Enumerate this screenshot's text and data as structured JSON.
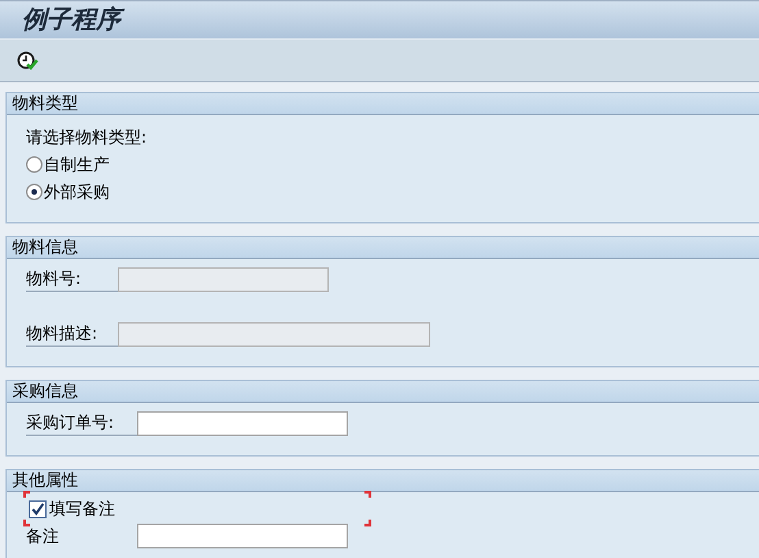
{
  "window": {
    "title": "例子程序"
  },
  "groups": [
    {
      "title": "物料类型",
      "items": [
        {
          "kind": "label",
          "text": "请选择物料类型:"
        },
        {
          "kind": "radio",
          "label": "自制生产",
          "selected": false
        },
        {
          "kind": "radio",
          "label": "外部采购",
          "selected": true
        }
      ]
    },
    {
      "title": "物料信息",
      "items": [
        {
          "kind": "field",
          "label": "物料号:",
          "disabled": true
        },
        {
          "kind": "field",
          "label": "物料描述:",
          "disabled": true
        }
      ]
    },
    {
      "title": "采购信息",
      "items": [
        {
          "kind": "field",
          "label": "采购订单号:",
          "disabled": false
        }
      ]
    },
    {
      "title": "其他属性",
      "items": [
        {
          "kind": "checkbox",
          "label": "填写备注",
          "checked": true,
          "focused": true
        },
        {
          "kind": "field",
          "label": "备注",
          "disabled": false
        }
      ]
    }
  ]
}
